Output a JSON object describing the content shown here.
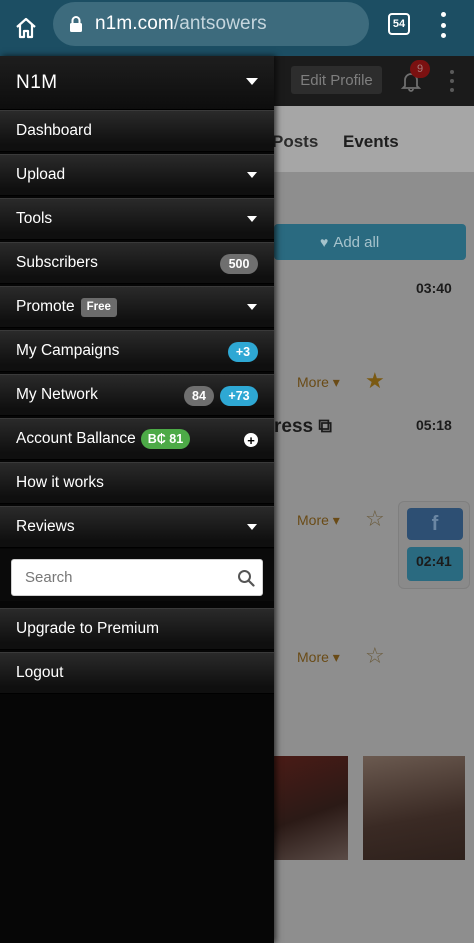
{
  "browser": {
    "url_domain": "n1m.com",
    "url_path": "/antsowers",
    "tab_count": "54"
  },
  "background_page": {
    "edit_profile_label": "Edit Profile",
    "notification_count": "9",
    "tabs": [
      "Posts",
      "Events"
    ],
    "add_all_label": "Add all",
    "times": [
      "03:40",
      "05:18",
      "02:41"
    ],
    "more_label": "More",
    "partial_title": "ress"
  },
  "drawer": {
    "brand": "N1M",
    "items": [
      {
        "label": "Dashboard"
      },
      {
        "label": "Upload"
      },
      {
        "label": "Tools"
      },
      {
        "label": "Subscribers",
        "badge": "500"
      },
      {
        "label": "Promote",
        "tag": "Free"
      },
      {
        "label": "My Campaigns",
        "badge": "+3"
      },
      {
        "label": "My Network",
        "badge_gray": "84",
        "badge_blue": "+73"
      },
      {
        "label": "Account Ballance",
        "balance": "B₵ 81"
      },
      {
        "label": "How it works"
      },
      {
        "label": "Reviews"
      }
    ],
    "search_placeholder": "Search",
    "upgrade_label": "Upgrade to Premium",
    "logout_label": "Logout"
  }
}
